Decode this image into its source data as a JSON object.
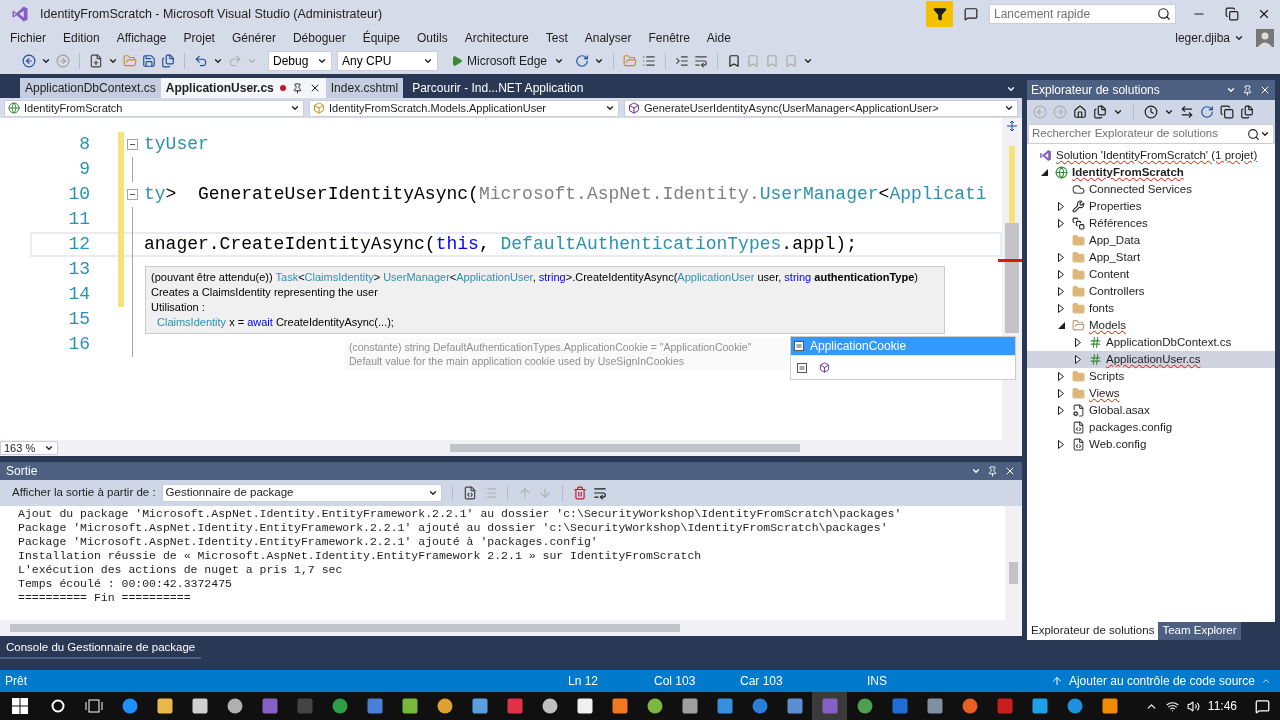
{
  "window": {
    "title": "IdentityFromScratch - Microsoft Visual Studio (Administrateur)",
    "quick_launch": {
      "placeholder": "Lancement rapide"
    },
    "user": "leger.djiba"
  },
  "menu": [
    "Fichier",
    "Edition",
    "Affichage",
    "Projet",
    "Générer",
    "Déboguer",
    "Équipe",
    "Outils",
    "Architecture",
    "Test",
    "Analyser",
    "Fenêtre",
    "Aide"
  ],
  "toolbar": {
    "configuration": "Debug",
    "platform": "Any CPU",
    "run_target": "Microsoft Edge"
  },
  "document_tabs": [
    {
      "label": "ApplicationDbContext.cs",
      "kind": "document",
      "selected": false,
      "modified": false
    },
    {
      "label": "ApplicationUser.cs",
      "kind": "document",
      "selected": true,
      "modified": true
    },
    {
      "label": "Index.cshtml",
      "kind": "document",
      "selected": false,
      "modified": false
    },
    {
      "label": "Parcourir - Ind...NET Application",
      "kind": "browser",
      "selected": false,
      "modified": false
    }
  ],
  "navigation_bar": {
    "project": "IdentityFromScratch",
    "type": "IdentityFromScratch.Models.ApplicationUser",
    "member": "GenerateUserIdentityAsync(UserManager<ApplicationUser>"
  },
  "editor": {
    "zoom": "163 %",
    "lines": [
      {
        "number": "8",
        "changed": true,
        "fold": true,
        "current": false,
        "segments": [
          {
            "kind": "type",
            "text": "tyUser"
          }
        ]
      },
      {
        "number": "9",
        "changed": true,
        "fold": false,
        "current": false
      },
      {
        "number": "10",
        "changed": true,
        "fold": true,
        "current": false,
        "segments": [
          {
            "kind": "type",
            "text": "ty"
          },
          {
            "kind": "plain",
            "text": ">  GenerateUserIdentityAsync("
          },
          {
            "kind": "dim",
            "text": "Microsoft.AspNet.Identity."
          },
          {
            "kind": "type",
            "text": "UserManager"
          },
          {
            "kind": "plain",
            "text": "<"
          },
          {
            "kind": "type",
            "text": "Applicati"
          }
        ]
      },
      {
        "number": "11",
        "changed": true,
        "fold": false,
        "current": false
      },
      {
        "number": "12",
        "changed": true,
        "fold": false,
        "current": true,
        "segments": [
          {
            "kind": "plain",
            "text": "anager.CreateIdentityAsync("
          },
          {
            "kind": "keyword",
            "text": "this"
          },
          {
            "kind": "plain",
            "text": ", "
          },
          {
            "kind": "type",
            "text": "DefaultAuthenticationTypes"
          },
          {
            "kind": "plain",
            "text": ".appl);"
          }
        ]
      },
      {
        "number": "13",
        "changed": true,
        "fold": false,
        "current": false
      },
      {
        "number": "14",
        "changed": true,
        "fold": false,
        "current": false
      },
      {
        "number": "15",
        "changed": false,
        "fold": false,
        "current": false
      },
      {
        "number": "16",
        "changed": false,
        "fold": false,
        "current": false
      }
    ]
  },
  "quick_info": {
    "signature": [
      {
        "kind": "plain",
        "text": "(pouvant être attendu(e)) "
      },
      {
        "kind": "type",
        "text": "Task"
      },
      {
        "kind": "plain",
        "text": "<"
      },
      {
        "kind": "type",
        "text": "ClaimsIdentity"
      },
      {
        "kind": "plain",
        "text": "> "
      },
      {
        "kind": "type",
        "text": "UserManager"
      },
      {
        "kind": "plain",
        "text": "<"
      },
      {
        "kind": "type",
        "text": "ApplicationUser"
      },
      {
        "kind": "plain",
        "text": ", "
      },
      {
        "kind": "keyword",
        "text": "string"
      },
      {
        "kind": "plain",
        "text": ">.CreateIdentityAsync("
      },
      {
        "kind": "type",
        "text": "ApplicationUser"
      },
      {
        "kind": "plain",
        "text": " user, "
      },
      {
        "kind": "keyword",
        "text": "string"
      },
      {
        "kind": "bold",
        "text": " authenticationType"
      },
      {
        "kind": "plain",
        "text": ")"
      }
    ],
    "description": "Creates a ClaimsIdentity representing the user",
    "usage_label": "Utilisation :",
    "usage": [
      {
        "kind": "type",
        "text": "ClaimsIdentity"
      },
      {
        "kind": "plain",
        "text": " x = "
      },
      {
        "kind": "keyword",
        "text": "await"
      },
      {
        "kind": "plain",
        "text": " CreateIdentityAsync(...);"
      }
    ]
  },
  "completion": {
    "tooltip": {
      "signature": "(constante) string DefaultAuthenticationTypes.ApplicationCookie = \"ApplicationCookie\"",
      "description": "Default value for the main application cookie used by UseSignInCookies"
    },
    "items": [
      {
        "label": "ApplicationCookie",
        "selected": true
      }
    ]
  },
  "output": {
    "title": "Sortie",
    "source_label": "Afficher la sortie à partir de :",
    "source": "Gestionnaire de package",
    "lines": [
      "Ajout du package 'Microsoft.AspNet.Identity.EntityFramework.2.2.1' au dossier 'c:\\SecurityWorkshop\\IdentityFromScratch\\packages'",
      "Package 'Microsoft.AspNet.Identity.EntityFramework.2.2.1' ajouté au dossier 'c:\\SecurityWorkshop\\IdentityFromScratch\\packages'",
      "Package 'Microsoft.AspNet.Identity.EntityFramework.2.2.1' ajouté à 'packages.config'",
      "Installation réussie de « Microsoft.AspNet.Identity.EntityFramework 2.2.1 » sur IdentityFromScratch",
      "L'exécution des actions de nuget a pris 1,7 sec",
      "Temps écoulé : 00:00:42.3372475",
      "========== Fin =========="
    ]
  },
  "bottom_panel_tabs": [
    "Console du Gestionnaire de package"
  ],
  "solution_explorer": {
    "title": "Explorateur de solutions",
    "search": {
      "placeholder": "Rechercher Explorateur de solutions"
    },
    "tree": [
      {
        "label": "Solution 'IdentityFromScratch' (1 projet)",
        "kind": "solution",
        "expandable": false,
        "selected": false,
        "spell_error": true,
        "children": [
          {
            "label": "IdentityFromScratch",
            "kind": "project",
            "expandable": true,
            "expanded": true,
            "selected": false,
            "spell_error": true,
            "children": [
              {
                "label": "Connected Services",
                "kind": "service",
                "expandable": false,
                "selected": false,
                "spell_error": false
              },
              {
                "label": "Properties",
                "kind": "properties",
                "expandable": true,
                "expanded": false,
                "selected": false,
                "spell_error": false
              },
              {
                "label": "Références",
                "kind": "references",
                "expandable": true,
                "expanded": false,
                "selected": false,
                "spell_error": false
              },
              {
                "label": "App_Data",
                "kind": "folder",
                "expandable": false,
                "expanded": false,
                "selected": false,
                "spell_error": false
              },
              {
                "label": "App_Start",
                "kind": "folder",
                "expandable": true,
                "expanded": false,
                "selected": false,
                "spell_error": false
              },
              {
                "label": "Content",
                "kind": "folder",
                "expandable": true,
                "expanded": false,
                "selected": false,
                "spell_error": false
              },
              {
                "label": "Controllers",
                "kind": "folder",
                "expandable": true,
                "expanded": false,
                "selected": false,
                "spell_error": false
              },
              {
                "label": "fonts",
                "kind": "folder",
                "expandable": true,
                "expanded": false,
                "selected": false,
                "spell_error": false
              },
              {
                "label": "Models",
                "kind": "folder",
                "expandable": true,
                "expanded": true,
                "selected": false,
                "spell_error": true,
                "children": [
                  {
                    "label": "ApplicationDbContext.cs",
                    "kind": "csharp",
                    "expandable": true,
                    "expanded": false,
                    "selected": false,
                    "spell_error": false
                  },
                  {
                    "label": "ApplicationUser.cs",
                    "kind": "csharp",
                    "expandable": true,
                    "expanded": false,
                    "selected": true,
                    "spell_error": true
                  }
                ]
              },
              {
                "label": "Scripts",
                "kind": "folder",
                "expandable": true,
                "expanded": false,
                "selected": false,
                "spell_error": false
              },
              {
                "label": "Views",
                "kind": "folder",
                "expandable": true,
                "expanded": false,
                "selected": false,
                "spell_error": true
              },
              {
                "label": "Global.asax",
                "kind": "asax",
                "expandable": true,
                "expanded": false,
                "selected": false,
                "spell_error": false
              },
              {
                "label": "packages.config",
                "kind": "config",
                "expandable": false,
                "selected": false,
                "spell_error": false
              },
              {
                "label": "Web.config",
                "kind": "config",
                "expandable": true,
                "expanded": false,
                "selected": false,
                "spell_error": false
              }
            ]
          }
        ]
      }
    ],
    "tabs": [
      {
        "label": "Explorateur de solutions",
        "selected": true
      },
      {
        "label": "Team Explorer",
        "selected": false
      }
    ]
  },
  "status_bar": {
    "state": "Prêt",
    "line": "Ln 12",
    "column": "Col 103",
    "character": "Car 103",
    "mode": "INS",
    "source_control": "Ajouter au contrôle de code source"
  },
  "taskbar": {
    "time": "11:46"
  }
}
